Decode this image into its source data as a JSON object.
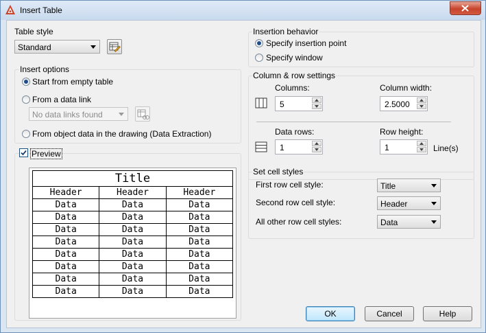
{
  "window": {
    "title": "Insert Table",
    "accent": "#c7442b"
  },
  "table_style": {
    "group_label": "Table style",
    "value": "Standard",
    "dialog_icon": "table-style-dialog-icon"
  },
  "insert_options": {
    "group_label": "Insert options",
    "start_empty": "Start from empty table",
    "from_data_link": "From a data link",
    "data_link_value": "No data links found",
    "from_object_data": "From object data in the drawing (Data Extraction)",
    "selected": "start_empty"
  },
  "preview": {
    "label": "Preview",
    "checked": true
  },
  "preview_table": {
    "title": "Title",
    "headers": [
      "Header",
      "Header",
      "Header"
    ],
    "rows": [
      [
        "Data",
        "Data",
        "Data"
      ],
      [
        "Data",
        "Data",
        "Data"
      ],
      [
        "Data",
        "Data",
        "Data"
      ],
      [
        "Data",
        "Data",
        "Data"
      ],
      [
        "Data",
        "Data",
        "Data"
      ],
      [
        "Data",
        "Data",
        "Data"
      ],
      [
        "Data",
        "Data",
        "Data"
      ],
      [
        "Data",
        "Data",
        "Data"
      ]
    ]
  },
  "insertion_behavior": {
    "group_label": "Insertion behavior",
    "insertion_point": "Specify insertion point",
    "window": "Specify window",
    "selected": "insertion_point"
  },
  "column_row": {
    "group_label": "Column & row settings",
    "columns_label": "Columns:",
    "columns": "5",
    "column_width_label": "Column width:",
    "column_width": "2.5000",
    "data_rows_label": "Data rows:",
    "data_rows": "1",
    "row_height_label": "Row height:",
    "row_height": "1",
    "lines_label": "Line(s)"
  },
  "cell_styles": {
    "group_label": "Set cell styles",
    "first_label": "First row cell style:",
    "first": "Title",
    "second_label": "Second row cell style:",
    "second": "Header",
    "other_label": "All other row cell styles:",
    "other": "Data"
  },
  "buttons": {
    "ok": "OK",
    "cancel": "Cancel",
    "help": "Help"
  }
}
